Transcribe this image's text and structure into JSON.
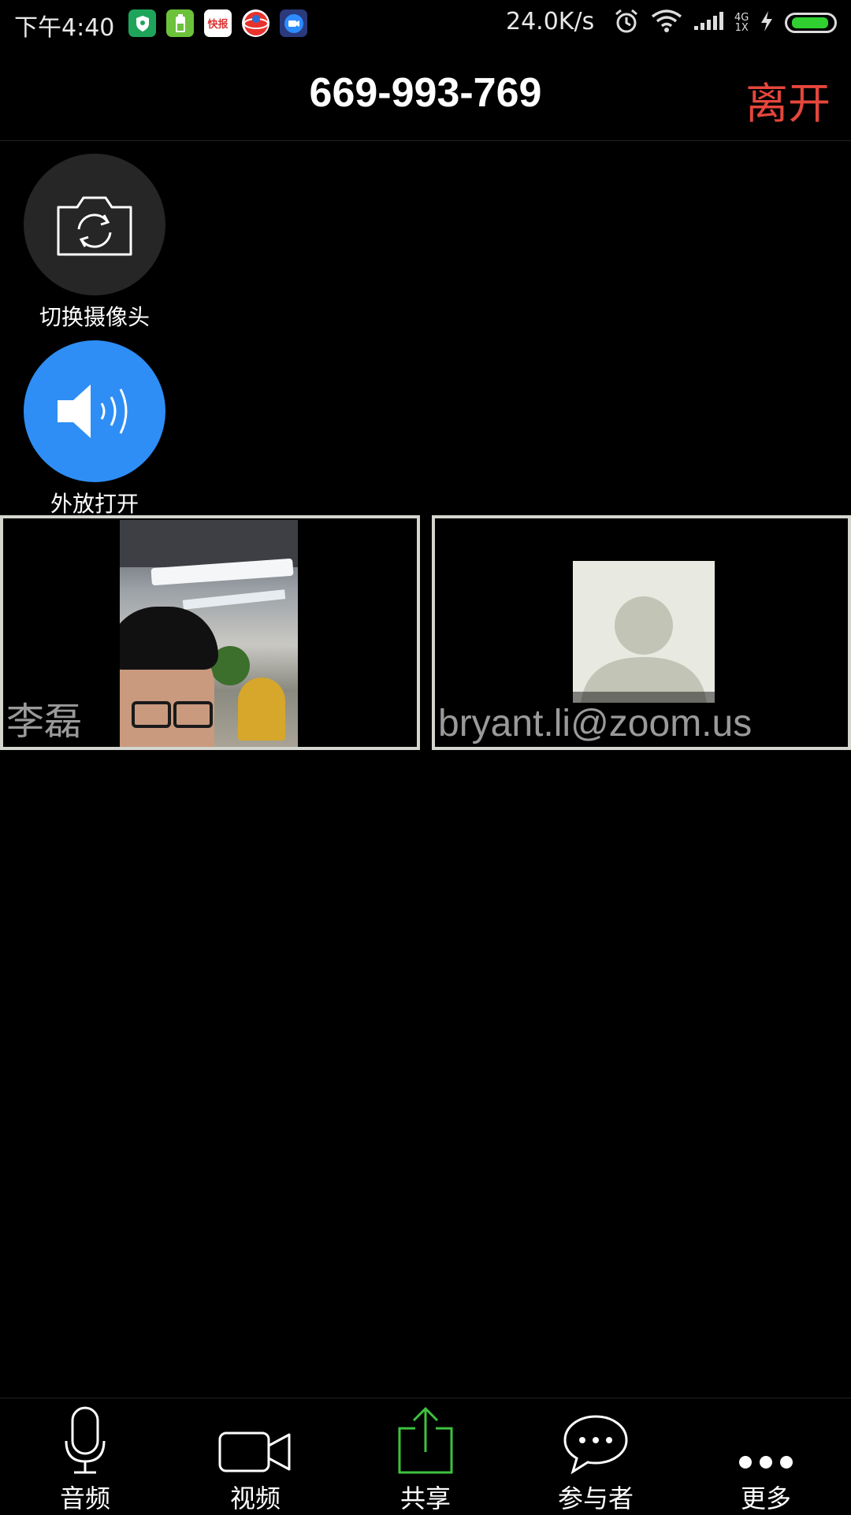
{
  "status_bar": {
    "time": "下午4:40",
    "net_speed": "24.0K/s",
    "net_type_top": "4G",
    "net_type_bottom": "1X",
    "app_icon_5g_text": "快报",
    "battery_level": 0.95,
    "battery_color": "#2fd02f"
  },
  "header": {
    "meeting_id": "669-993-769",
    "leave_label": "离开",
    "leave_color": "#e6463c"
  },
  "controls": {
    "switch_camera_label": "切换摄像头",
    "speaker_label": "外放打开",
    "speaker_color": "#2e8ef5"
  },
  "participants": [
    {
      "name": "李磊",
      "video": "camera"
    },
    {
      "name": "bryant.li@zoom.us",
      "video": "avatar"
    }
  ],
  "toolbar": {
    "items": [
      {
        "label": "音频",
        "icon": "microphone-icon"
      },
      {
        "label": "视频",
        "icon": "video-camera-icon"
      },
      {
        "label": "共享",
        "icon": "share-icon",
        "color": "#3ec23e"
      },
      {
        "label": "参与者",
        "icon": "chat-bubble-icon"
      },
      {
        "label": "更多",
        "icon": "more-icon"
      }
    ]
  }
}
